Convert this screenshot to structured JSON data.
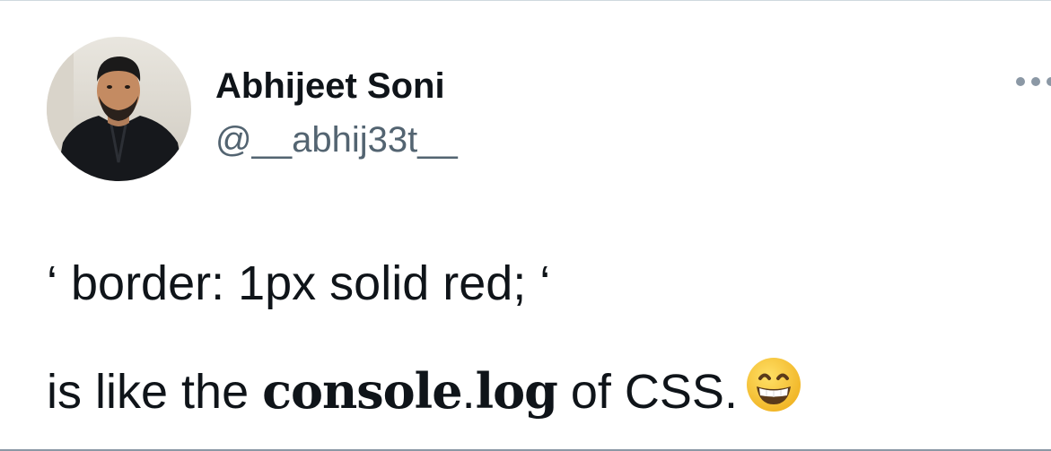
{
  "author": {
    "display_name": "Abhijeet Soni",
    "handle": "@__abhij33t__",
    "avatar": "profile-photo"
  },
  "menu": {
    "icon": "more-horizontal-icon"
  },
  "tweet": {
    "line1": "‘ border: 1px solid red; ‘",
    "line2_before": "is like the ",
    "line2_bold_1": "console",
    "line2_dot": ".",
    "line2_bold_2": "log",
    "line2_after": " of CSS.",
    "emoji": "grinning-face-with-smiling-eyes"
  },
  "colors": {
    "text_primary": "#0f1419",
    "text_secondary": "#536471",
    "icon_gray": "#8b98a5",
    "emoji_yellow": "#f7c52b"
  }
}
